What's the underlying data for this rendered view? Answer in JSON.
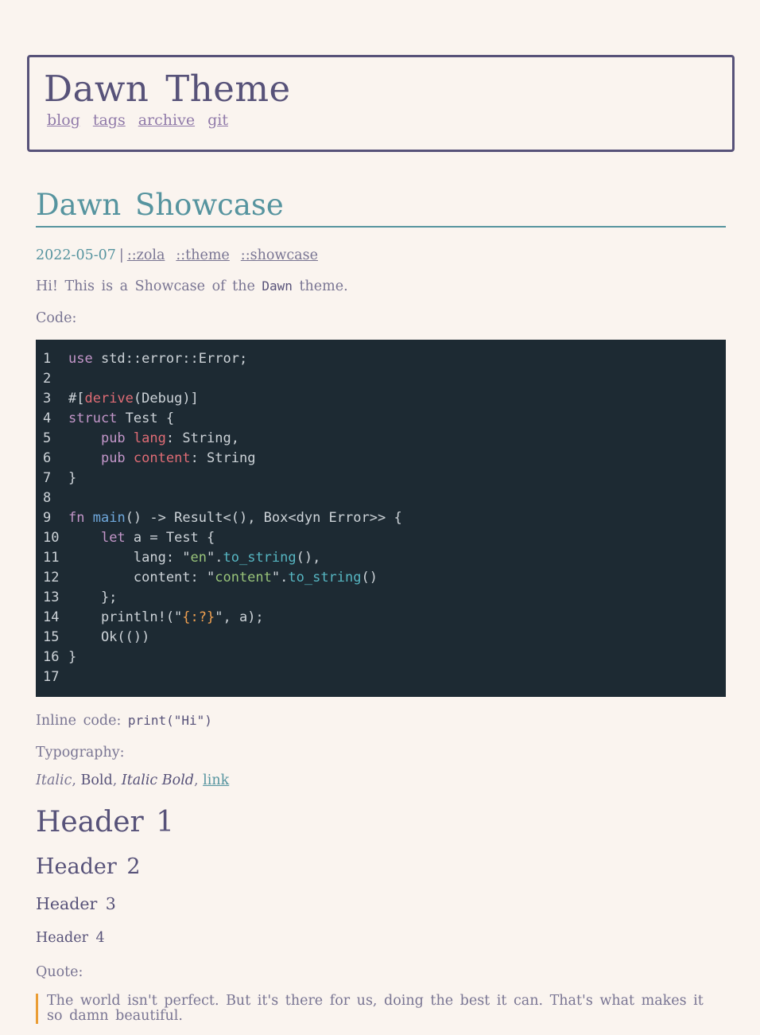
{
  "site": {
    "title": "Dawn Theme",
    "nav": [
      "blog",
      "tags",
      "archive",
      "git"
    ]
  },
  "post": {
    "title": "Dawn Showcase",
    "date": "2022-05-07",
    "separator": "|",
    "tags": [
      "::zola",
      "::theme",
      "::showcase"
    ],
    "intro_before": "Hi! This is a Showcase of the ",
    "intro_code": "Dawn",
    "intro_after": " theme.",
    "code_label": "Code:",
    "code_lines": [
      {
        "n": "1",
        "tokens": [
          [
            "kw",
            "use"
          ],
          [
            "plain",
            " std::error::Error;"
          ]
        ]
      },
      {
        "n": "2",
        "tokens": []
      },
      {
        "n": "3",
        "tokens": [
          [
            "plain",
            "#["
          ],
          [
            "attr",
            "derive"
          ],
          [
            "plain",
            "(Debug)]"
          ]
        ]
      },
      {
        "n": "4",
        "tokens": [
          [
            "kw",
            "struct"
          ],
          [
            "plain",
            " Test {"
          ]
        ]
      },
      {
        "n": "5",
        "tokens": [
          [
            "plain",
            "    "
          ],
          [
            "kw",
            "pub"
          ],
          [
            "plain",
            " "
          ],
          [
            "attr",
            "lang"
          ],
          [
            "plain",
            ": String,"
          ]
        ]
      },
      {
        "n": "6",
        "tokens": [
          [
            "plain",
            "    "
          ],
          [
            "kw",
            "pub"
          ],
          [
            "plain",
            " "
          ],
          [
            "attr",
            "content"
          ],
          [
            "plain",
            ": String"
          ]
        ]
      },
      {
        "n": "7",
        "tokens": [
          [
            "plain",
            "}"
          ]
        ]
      },
      {
        "n": "8",
        "tokens": []
      },
      {
        "n": "9",
        "tokens": [
          [
            "kw",
            "fn"
          ],
          [
            "plain",
            " "
          ],
          [
            "fn",
            "main"
          ],
          [
            "plain",
            "() -> Result<(), Box<dyn Error>> {"
          ]
        ]
      },
      {
        "n": "10",
        "tokens": [
          [
            "plain",
            "    "
          ],
          [
            "kw",
            "let"
          ],
          [
            "plain",
            " a = Test {"
          ]
        ]
      },
      {
        "n": "11",
        "tokens": [
          [
            "plain",
            "        lang: \""
          ],
          [
            "str",
            "en"
          ],
          [
            "plain",
            "\"."
          ],
          [
            "method",
            "to_string"
          ],
          [
            "plain",
            "(),"
          ]
        ]
      },
      {
        "n": "12",
        "tokens": [
          [
            "plain",
            "        content: \""
          ],
          [
            "str",
            "content"
          ],
          [
            "plain",
            "\"."
          ],
          [
            "method",
            "to_string"
          ],
          [
            "plain",
            "()"
          ]
        ]
      },
      {
        "n": "13",
        "tokens": [
          [
            "plain",
            "    };"
          ]
        ]
      },
      {
        "n": "14",
        "tokens": [
          [
            "plain",
            "    println!(\""
          ],
          [
            "fmt",
            "{:?}"
          ],
          [
            "plain",
            "\", a);"
          ]
        ]
      },
      {
        "n": "15",
        "tokens": [
          [
            "plain",
            "    Ok(())"
          ]
        ]
      },
      {
        "n": "16",
        "tokens": [
          [
            "plain",
            "}"
          ]
        ]
      },
      {
        "n": "17",
        "tokens": []
      }
    ],
    "inline_code_label": "Inline code: ",
    "inline_code": "print(\"Hi\")",
    "typography_label": "Typography:",
    "typography": {
      "italic": "Italic",
      "bold": "Bold",
      "italic_bold": "Italic Bold",
      "link": "link",
      "comma": ", "
    },
    "headers": [
      "Header 1",
      "Header 2",
      "Header 3",
      "Header 4"
    ],
    "quote_label": "Quote:",
    "quote": "The world isn't perfect. But it's there for us, doing the best it can. That's what makes it so damn beautiful."
  },
  "colors": {
    "background": "#faf4ef",
    "text": "#575279",
    "muted": "#797593",
    "accent": "#56949f",
    "nav_link": "#907aa9",
    "quote_border": "#ea9d34",
    "code_bg": "#1d2a33"
  }
}
